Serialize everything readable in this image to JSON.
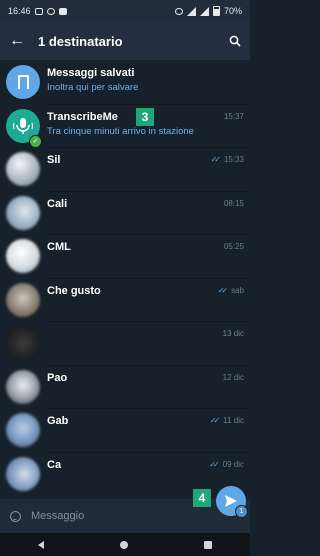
{
  "status_bar": {
    "time": "16:46",
    "battery": "70%"
  },
  "header": {
    "title": "1 destinatario"
  },
  "chats": [
    {
      "name": "Messaggi salvati",
      "preview": "Inoltra qui per salvare",
      "time": "",
      "read": false,
      "avatar": "bookmark-icon"
    },
    {
      "name": "TranscribeMe",
      "preview": "Tra cinque minuti arrivo in stazione",
      "time": "15:37",
      "read": false,
      "avatar": "microphone-icon",
      "selected": true
    },
    {
      "name": "Sil",
      "preview": "",
      "time": "15:33",
      "read": true
    },
    {
      "name": "Cali",
      "preview": "",
      "time": "08:15",
      "read": false
    },
    {
      "name": "CML",
      "preview": "",
      "time": "05:25",
      "read": false
    },
    {
      "name": "Che gusto",
      "preview": "",
      "time": "sab",
      "read": true
    },
    {
      "name": "",
      "preview": "",
      "time": "13 dic",
      "read": false
    },
    {
      "name": "Pao",
      "preview": "",
      "time": "12 dic",
      "read": false
    },
    {
      "name": "Gab",
      "preview": "",
      "time": "11 dic",
      "read": true
    },
    {
      "name": "Ca",
      "preview": "",
      "time": "09 dic",
      "read": true
    }
  ],
  "steps": {
    "step3": "3",
    "step4": "4"
  },
  "composer": {
    "placeholder": "Messaggio",
    "send_count": "1"
  },
  "colors": {
    "accent": "#5fa7e6",
    "background": "#17212b",
    "step_badge": "#21a677",
    "online_badge": "#4fae4e"
  }
}
